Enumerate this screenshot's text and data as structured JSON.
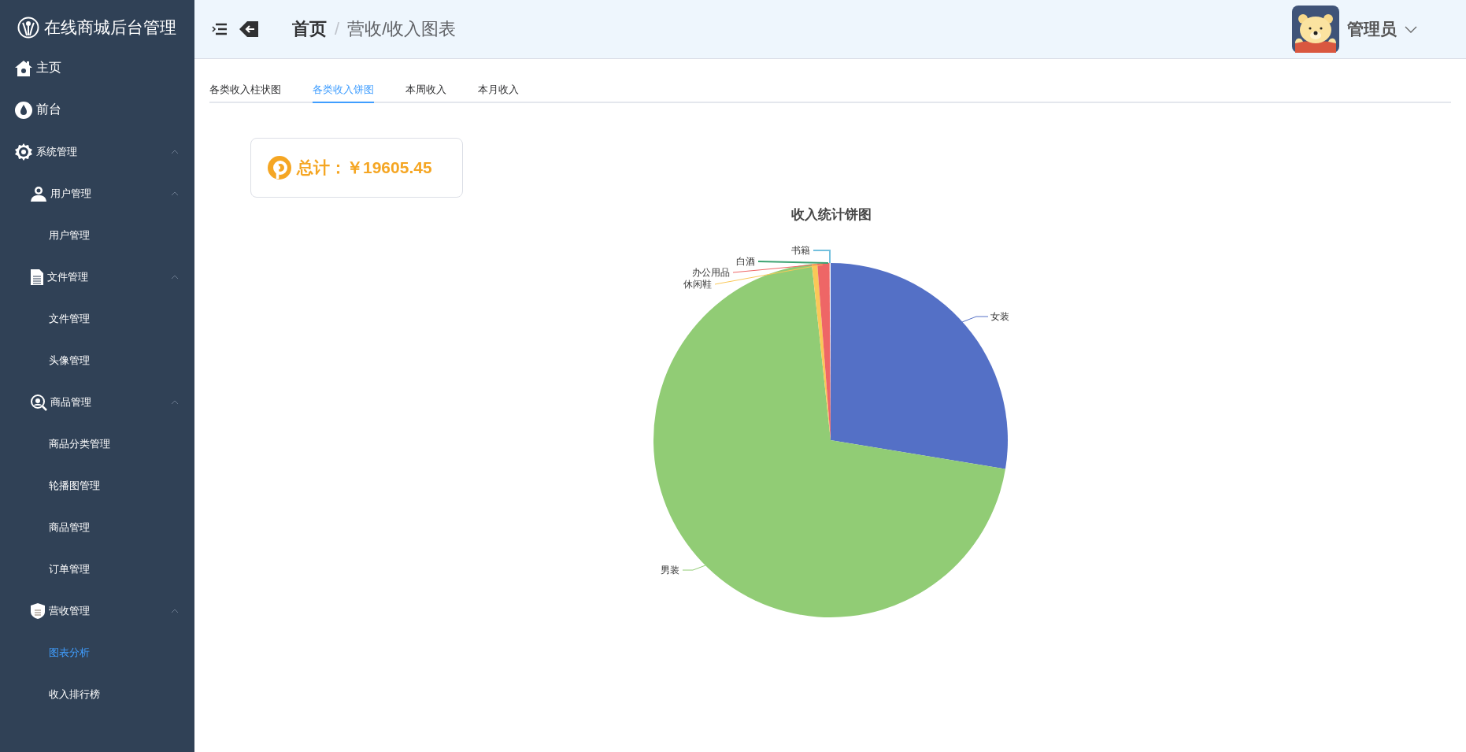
{
  "sidebar": {
    "logo": "在线商城后台管理",
    "items": [
      {
        "label": "主页",
        "selected": false
      },
      {
        "label": "前台",
        "selected": false
      },
      {
        "label": "系统管理",
        "expanded": true,
        "children": [
          {
            "label": "用户管理",
            "expanded": true,
            "children": [
              {
                "label": "用户管理",
                "selected": false
              }
            ]
          },
          {
            "label": "文件管理",
            "expanded": true,
            "children": [
              {
                "label": "文件管理",
                "selected": false
              },
              {
                "label": "头像管理",
                "selected": false
              }
            ]
          },
          {
            "label": "商品管理",
            "expanded": true,
            "children": [
              {
                "label": "商品分类管理",
                "selected": false
              },
              {
                "label": "轮播图管理",
                "selected": false
              },
              {
                "label": "商品管理",
                "selected": false
              },
              {
                "label": "订单管理",
                "selected": false
              }
            ]
          },
          {
            "label": "营收管理",
            "expanded": true,
            "children": [
              {
                "label": "图表分析",
                "selected": true
              },
              {
                "label": "收入排行榜",
                "selected": false
              }
            ]
          }
        ]
      }
    ]
  },
  "header": {
    "breadcrumb": [
      "首页",
      "营收/收入图表"
    ],
    "separator": "/",
    "user": "管理员"
  },
  "tabs": [
    {
      "label": "各类收入柱状图",
      "selected": false
    },
    {
      "label": "各类收入饼图",
      "selected": true
    },
    {
      "label": "本周收入",
      "selected": false
    },
    {
      "label": "本月收入",
      "selected": false
    }
  ],
  "total": {
    "label": "总计：",
    "value": "￥19605.45"
  },
  "pie": {
    "title": "收入统计饼图",
    "slices": [
      {
        "label": "女装",
        "color": "#5470c6"
      },
      {
        "label": "男装",
        "color": "#91cc75"
      },
      {
        "label": "休闲鞋",
        "color": "#fac858"
      },
      {
        "label": "办公用品",
        "color": "#ee6666"
      },
      {
        "label": "白酒",
        "color": "#3ba272"
      },
      {
        "label": "书籍",
        "color": "#73c0de"
      }
    ]
  }
}
